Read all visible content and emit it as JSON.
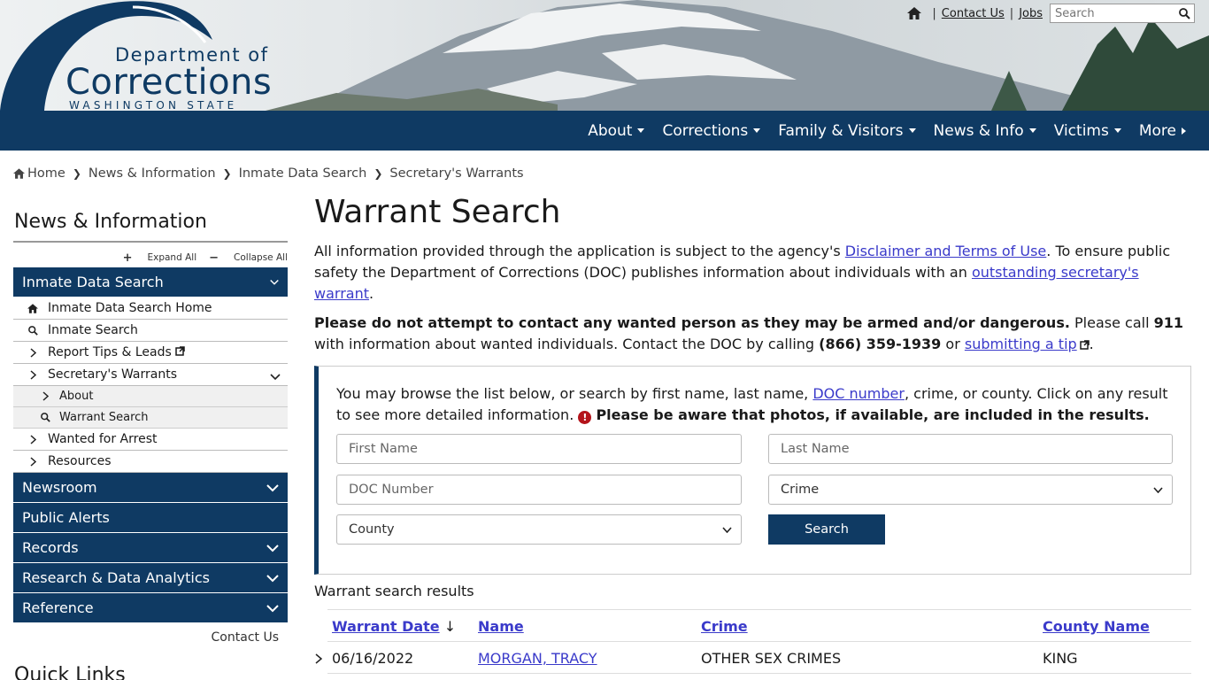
{
  "header": {
    "logo_line1": "Department of",
    "logo_line2": "Corrections",
    "logo_line3": "WASHINGTON STATE",
    "utility": {
      "contact": "Contact Us",
      "jobs": "Jobs",
      "search_placeholder": "Search"
    }
  },
  "nav": {
    "items": [
      {
        "label": "About",
        "icon": "caret-down"
      },
      {
        "label": "Corrections",
        "icon": "caret-down"
      },
      {
        "label": "Family & Visitors",
        "icon": "caret-down"
      },
      {
        "label": "News & Info",
        "icon": "caret-down"
      },
      {
        "label": "Victims",
        "icon": "caret-down"
      },
      {
        "label": "More",
        "icon": "caret-right"
      }
    ]
  },
  "breadcrumb": [
    "Home",
    "News & Information",
    "Inmate Data Search",
    "Secretary's Warrants"
  ],
  "sidebar": {
    "title": "News & Information",
    "expand_all": "Expand All",
    "collapse_all": "Collapse All",
    "section_open": "Inmate Data Search",
    "items": [
      {
        "label": "Inmate Data Search Home",
        "icon": "home-icon"
      },
      {
        "label": "Inmate Search",
        "icon": "search-icon"
      },
      {
        "label": "Report Tips & Leads",
        "icon": "chevron-right-icon"
      },
      {
        "label": "Secretary's Warrants",
        "icon": "chevron-right-icon"
      }
    ],
    "sub_items": [
      {
        "label": "About",
        "icon": "chevron-right-icon"
      },
      {
        "label": "Warrant Search",
        "icon": "search-icon"
      }
    ],
    "items_after": [
      {
        "label": "Wanted for Arrest",
        "icon": "chevron-right-icon"
      },
      {
        "label": "Resources",
        "icon": "chevron-right-icon"
      }
    ],
    "sections": [
      {
        "label": "Newsroom",
        "has_arrow": true
      },
      {
        "label": "Public Alerts",
        "has_arrow": false
      },
      {
        "label": "Records",
        "has_arrow": true
      },
      {
        "label": "Research & Data Analytics",
        "has_arrow": true
      },
      {
        "label": "Reference",
        "has_arrow": true
      }
    ],
    "contact": "Contact Us",
    "quick_links": "Quick Links"
  },
  "main": {
    "title": "Warrant Search",
    "p1_a": "All information provided through the application is subject to the agency's ",
    "p1_link1": "Disclaimer and Terms of Use",
    "p1_b": ". To ensure public safety the Department of Corrections (DOC) publishes information about individuals with an ",
    "p1_link2": "outstanding secretary's warrant",
    "p1_c": ".",
    "p2_bold": "Please do not attempt to contact any wanted person as they may be armed and/or dangerous.",
    "p2_a": " Please call ",
    "p2_911": "911",
    "p2_b": " with information about wanted individuals. Contact the DOC by calling ",
    "p2_phone": "(866) 359-1939",
    "p2_c": " or ",
    "p2_link": "submitting a tip",
    "p2_d": ".",
    "box_a": "You may browse the list below, or search by first name, last name, ",
    "box_link": "DOC number",
    "box_b": ", crime, or county. Click on any result to see more detailed information. ",
    "box_bold": "Please be aware that photos, if available, are included in the results.",
    "form": {
      "first_name": "First Name",
      "last_name": "Last Name",
      "doc_number": "DOC Number",
      "crime": "Crime",
      "county": "County",
      "search": "Search"
    }
  },
  "results": {
    "title": "Warrant search results",
    "columns": [
      "Warrant Date",
      "Name",
      "Crime",
      "County Name"
    ],
    "sort_indicator": "↓",
    "rows": [
      {
        "date": "06/16/2022",
        "name": "MORGAN, TRACY",
        "crime": "OTHER SEX CRIMES",
        "county": "KING"
      }
    ]
  }
}
